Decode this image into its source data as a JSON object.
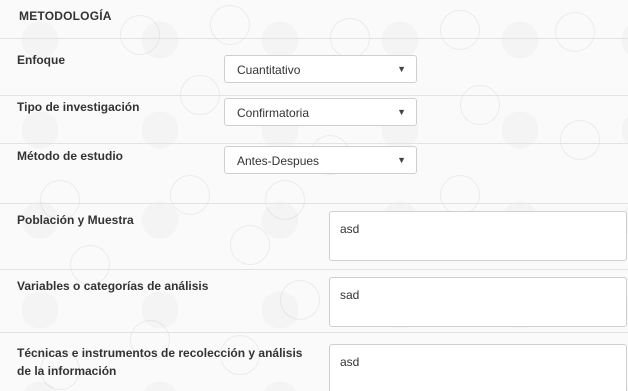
{
  "section": {
    "title": "METODOLOGÍA"
  },
  "fields": {
    "enfoque": {
      "label": "Enfoque",
      "value": "Cuantitativo"
    },
    "tipo": {
      "label": "Tipo de investigación",
      "value": "Confirmatoria"
    },
    "metodo": {
      "label": "Método de estudio",
      "value": "Antes-Despues"
    },
    "poblacion": {
      "label": "Población y Muestra",
      "value": "asd"
    },
    "variables": {
      "label": "Variables o categorías de análisis",
      "value": "sad"
    },
    "tecnicas": {
      "label": "Técnicas e instrumentos de recolección y análisis de la información",
      "value": "asd"
    }
  },
  "icons": {
    "dropdown": "chevron-down-icon"
  }
}
